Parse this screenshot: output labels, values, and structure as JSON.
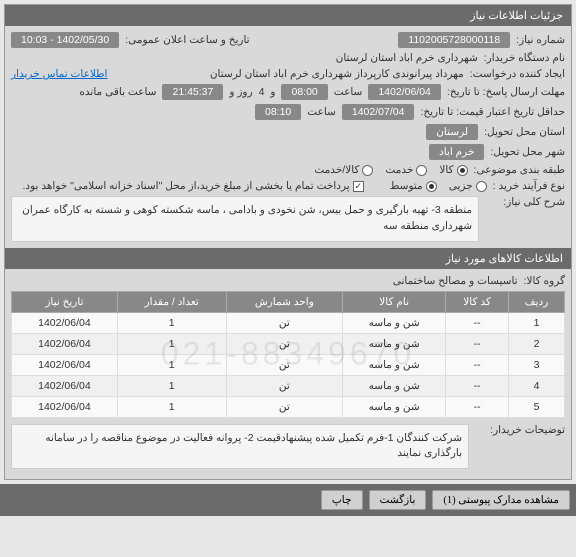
{
  "header": {
    "title": "جزئیات اطلاعات نیاز"
  },
  "fields": {
    "need_number_label": "شماره نیاز:",
    "need_number": "1102005728000118",
    "announce_label": "تاریخ و ساعت اعلان عمومی:",
    "announce_value": "1402/05/30 - 10:03",
    "buyer_label": "نام دستگاه خریدار:",
    "buyer_value": "شهرداری خرم اباد استان لرستان",
    "requester_label": "ایجاد کننده درخواست:",
    "requester_value": "مهرداد پیرانوندی کارپرداز شهرداری خرم اباد استان لرستان",
    "contact_label": "اطلاعات تماس خریدار",
    "deadline_label": "مهلت ارسال پاسخ: تا تاریخ:",
    "deadline_date": "1402/06/04",
    "time_label": "ساعت",
    "deadline_time": "08:00",
    "remaining_prefix": "و",
    "remaining_days": "4",
    "remaining_days_label": "روز و",
    "remaining_time": "21:45:37",
    "remaining_suffix": "ساعت باقی مانده",
    "validity_label": "حداقل تاریخ اعتبار قیمت: تا تاریخ:",
    "validity_date": "1402/07/04",
    "validity_time": "08:10",
    "province_label": "استان محل تحویل:",
    "province_value": "لرستان",
    "city_label": "شهر محل تحویل:",
    "city_value": "خرم اباد",
    "subject_label": "طبقه بندی موضوعی:",
    "process_label": "نوع فرآیند خرید :",
    "payment_note": "پرداخت تمام یا بخشی از مبلغ خرید،از محل \"اسناد خزانه اسلامی\" خواهد بود.",
    "need_desc_label": "شرح کلی نیاز:",
    "need_desc": "منطقه 3- تهیه بارگیری و حمل بیس، شن نخودی و بادامی ، ماسه شکسته کوهی و شسته به کارگاه عمران شهرداری منطقه سه",
    "goods_header": "اطلاعات کالاهای مورد نیاز",
    "group_label": "گروه کالا:",
    "group_value": "تاسیسات و مصالح ساختمانی",
    "buyer_notes_label": "توضیحات خریدار:",
    "buyer_notes": "شرکت کنندگان 1-فرم تکمیل شده پیشنهادقیمت 2- پروانه فعالیت در موضوع مناقصه را در سامانه بارگذاری نمایند"
  },
  "radios": {
    "r_goods": "کالا",
    "r_service": "خدمت",
    "r_both": "کالا/خدمت",
    "r_juzi": "جزیی",
    "r_mid": "متوسط"
  },
  "table": {
    "headers": {
      "row": "ردیف",
      "code": "کد کالا",
      "name": "نام کالا",
      "count_unit": "واحد شمارش",
      "qty": "تعداد / مقدار",
      "need_date": "تاریخ نیاز"
    },
    "rows": [
      {
        "i": "1",
        "code": "--",
        "name": "شن و ماسه",
        "unit": "تن",
        "qty": "1",
        "date": "1402/06/04"
      },
      {
        "i": "2",
        "code": "--",
        "name": "شن و ماسه",
        "unit": "تن",
        "qty": "1",
        "date": "1402/06/04"
      },
      {
        "i": "3",
        "code": "--",
        "name": "شن و ماسه",
        "unit": "تن",
        "qty": "1",
        "date": "1402/06/04"
      },
      {
        "i": "4",
        "code": "--",
        "name": "شن و ماسه",
        "unit": "تن",
        "qty": "1",
        "date": "1402/06/04"
      },
      {
        "i": "5",
        "code": "--",
        "name": "شن و ماسه",
        "unit": "تن",
        "qty": "1",
        "date": "1402/06/04"
      }
    ]
  },
  "watermark": "021-88349670",
  "footer": {
    "attachments": "مشاهده مدارک پیوستی (1)",
    "back": "بازگشت",
    "print": "چاپ"
  }
}
